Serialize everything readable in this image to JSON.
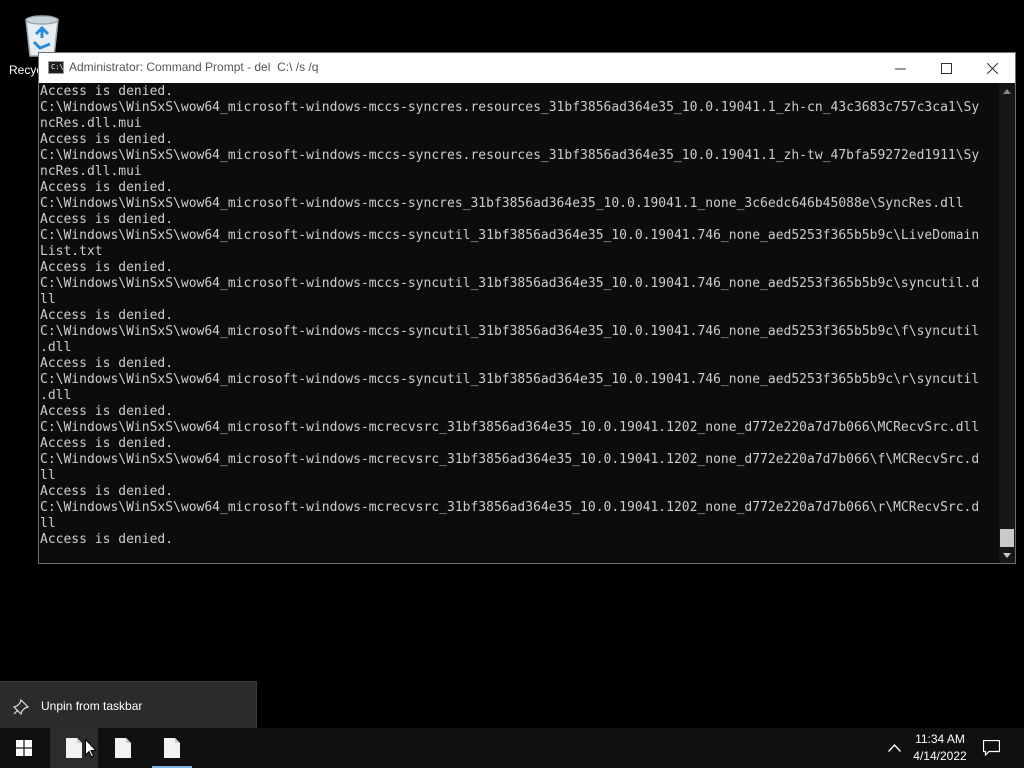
{
  "desktop": {
    "recycle_bin": {
      "label": "Recyc",
      "icon": "recycle-bin-icon"
    }
  },
  "window": {
    "title": "Administrator: Command Prompt - del  C:\\ /s /q",
    "icon": "cmd-icon",
    "icon_text": "C:\\_",
    "controls": [
      "minimize",
      "maximize",
      "close"
    ]
  },
  "console": {
    "lines": [
      "Access is denied.",
      "C:\\Windows\\WinSxS\\wow64_microsoft-windows-mccs-syncres.resources_31bf3856ad364e35_10.0.19041.1_zh-cn_43c3683c757c3ca1\\Sy",
      "ncRes.dll.mui",
      "Access is denied.",
      "C:\\Windows\\WinSxS\\wow64_microsoft-windows-mccs-syncres.resources_31bf3856ad364e35_10.0.19041.1_zh-tw_47bfa59272ed1911\\Sy",
      "ncRes.dll.mui",
      "Access is denied.",
      "C:\\Windows\\WinSxS\\wow64_microsoft-windows-mccs-syncres_31bf3856ad364e35_10.0.19041.1_none_3c6edc646b45088e\\SyncRes.dll",
      "Access is denied.",
      "C:\\Windows\\WinSxS\\wow64_microsoft-windows-mccs-syncutil_31bf3856ad364e35_10.0.19041.746_none_aed5253f365b5b9c\\LiveDomain",
      "List.txt",
      "Access is denied.",
      "C:\\Windows\\WinSxS\\wow64_microsoft-windows-mccs-syncutil_31bf3856ad364e35_10.0.19041.746_none_aed5253f365b5b9c\\syncutil.d",
      "ll",
      "Access is denied.",
      "C:\\Windows\\WinSxS\\wow64_microsoft-windows-mccs-syncutil_31bf3856ad364e35_10.0.19041.746_none_aed5253f365b5b9c\\f\\syncutil",
      ".dll",
      "Access is denied.",
      "C:\\Windows\\WinSxS\\wow64_microsoft-windows-mccs-syncutil_31bf3856ad364e35_10.0.19041.746_none_aed5253f365b5b9c\\r\\syncutil",
      ".dll",
      "Access is denied.",
      "C:\\Windows\\WinSxS\\wow64_microsoft-windows-mcrecvsrc_31bf3856ad364e35_10.0.19041.1202_none_d772e220a7d7b066\\MCRecvSrc.dll",
      "Access is denied.",
      "C:\\Windows\\WinSxS\\wow64_microsoft-windows-mcrecvsrc_31bf3856ad364e35_10.0.19041.1202_none_d772e220a7d7b066\\f\\MCRecvSrc.d",
      "ll",
      "Access is denied.",
      "C:\\Windows\\WinSxS\\wow64_microsoft-windows-mcrecvsrc_31bf3856ad364e35_10.0.19041.1202_none_d772e220a7d7b066\\r\\MCRecvSrc.d",
      "ll",
      "Access is denied."
    ]
  },
  "context_menu": {
    "items": [
      {
        "label": "Unpin from taskbar",
        "icon": "unpin-icon"
      }
    ]
  },
  "taskbar": {
    "start_icon": "windows-start-icon",
    "pinned": [
      "file-icon",
      "file-icon",
      "file-icon"
    ],
    "tray_icon": "chevron-up-icon",
    "time": "11:34 AM",
    "date": "4/14/2022",
    "notification_icon": "action-center-icon"
  },
  "colors": {
    "console_bg": "#0c0c0c",
    "console_fg": "#cccccc",
    "taskbar_bg": "#101010",
    "active_indicator": "#7fb6e8"
  }
}
